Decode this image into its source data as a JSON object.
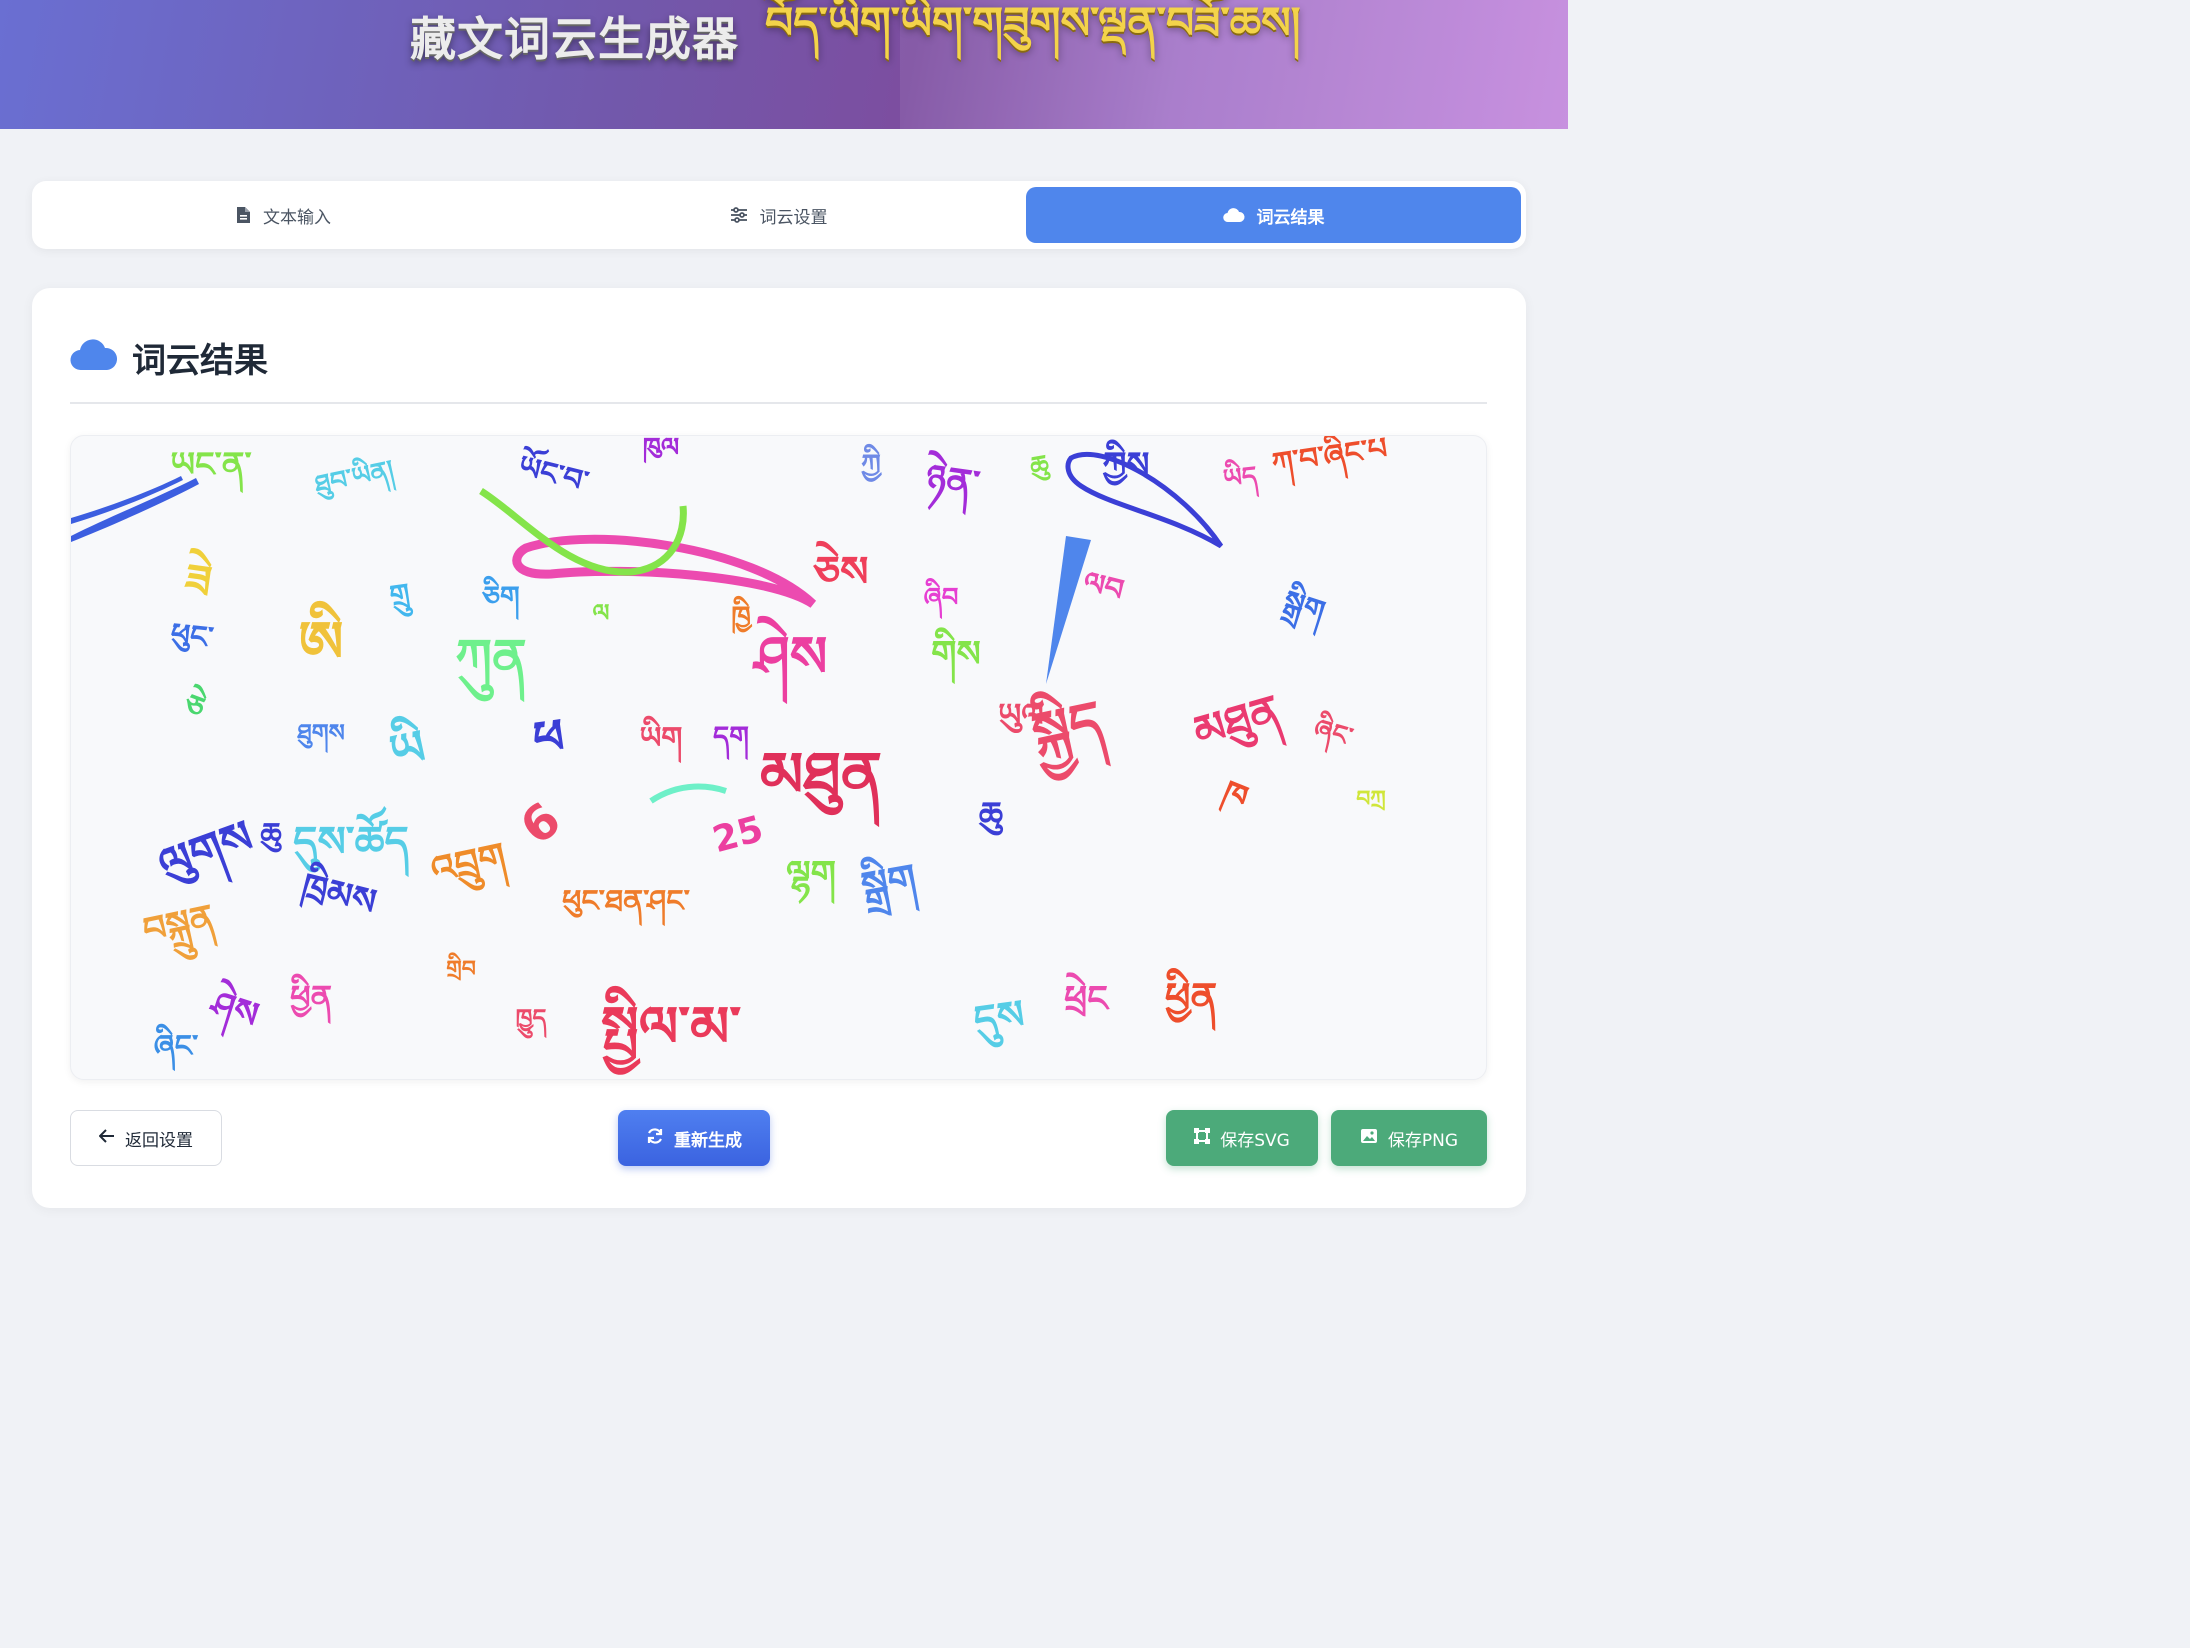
{
  "header": {
    "title_zh": "藏文词云生成器",
    "title_bo": "བོད་ཡིག་ཡིག་གཟུགས་ལྡན་བཟོ་ཆས།"
  },
  "tabs": [
    {
      "label": "文本输入",
      "icon": "file-icon",
      "active": false
    },
    {
      "label": "词云设置",
      "icon": "sliders-icon",
      "active": false
    },
    {
      "label": "词云结果",
      "icon": "cloud-icon",
      "active": true
    }
  ],
  "colors": {
    "accent": "#4f86ec",
    "save": "#4caa7a",
    "regen": "#3b63e0"
  },
  "result": {
    "title": "词云结果",
    "words": [
      {
        "t": "ཡང་ན་",
        "c": "#84e44a"
      },
      {
        "t": "ཐུབ་ཡིན།",
        "c": "#56cde6"
      },
      {
        "t": "ཡོང་བ་",
        "c": "#3b3fd6"
      },
      {
        "t": "ཁུལ",
        "c": "#a32cd9"
      },
      {
        "t": "ཀྱི",
        "c": "#6f8ae6"
      },
      {
        "t": "ཉེན་",
        "c": "#a32cd9"
      },
      {
        "t": "ཆུ",
        "c": "#84e44a"
      },
      {
        "t": "ཀྱིས",
        "c": "#3b3fd6"
      },
      {
        "t": "ཡིད",
        "c": "#ec4bb0"
      },
      {
        "t": "ཀ་བ་ཞིང་པ",
        "c": "#ee4e2c"
      },
      {
        "t": "ཟེ",
        "c": "#f0d03a"
      },
      {
        "t": "གྲུ",
        "c": "#42b7ee"
      },
      {
        "t": "ཅིག",
        "c": "#3b9fed"
      },
      {
        "t": "ལ",
        "c": "#84e44a"
      },
      {
        "t": "ཁྱི",
        "c": "#ef7c2a"
      },
      {
        "t": "ཅེས",
        "c": "#ef3f5a"
      },
      {
        "t": "ཞིབ",
        "c": "#e63fd2"
      },
      {
        "t": "ལབ",
        "c": "#ec4bb0"
      },
      {
        "t": "སྒྲིག",
        "c": "#3c6fe6"
      },
      {
        "t": "ཕུང་",
        "c": "#3c6fe6"
      },
      {
        "t": "ཅེ",
        "c": "#4ad76f"
      },
      {
        "t": "ཨི",
        "c": "#f0c23a"
      },
      {
        "t": "ཀུན",
        "c": "#6ef08c"
      },
      {
        "t": "ཤེས",
        "c": "#ec3fa0"
      },
      {
        "t": "གིས",
        "c": "#84e44a"
      },
      {
        "t": "ཐུགས",
        "c": "#4f86ec"
      },
      {
        "t": "ཡི",
        "c": "#56cde6"
      },
      {
        "t": "ཕ",
        "c": "#3b3fd6"
      },
      {
        "t": "ཡིག",
        "c": "#ec4b6b"
      },
      {
        "t": "དག",
        "c": "#a32cd9"
      },
      {
        "t": "མཐུན",
        "c": "#e0305a"
      },
      {
        "t": "ཆུ",
        "c": "#3b3fd6"
      },
      {
        "t": "ཡུལ",
        "c": "#ec4b6b"
      },
      {
        "t": "སྐྱིད",
        "c": "#ec4b6b"
      },
      {
        "t": "མཐུན",
        "c": "#ea3a70"
      },
      {
        "t": "ཞིང་",
        "c": "#ec4b6b"
      },
      {
        "t": "བཀྲ",
        "c": "#d0e63a"
      },
      {
        "t": "ཁ",
        "c": "#ee4e2c"
      },
      {
        "t": "ལུགས",
        "c": "#3b3fd6"
      },
      {
        "t": "ཆུ",
        "c": "#3b3fd6"
      },
      {
        "t": "དུས་ཚོད",
        "c": "#56cde6"
      },
      {
        "t": "འབྲུག",
        "c": "#ef8c2a"
      },
      {
        "t": "6",
        "c": "#ec4b6b"
      },
      {
        "t": "25",
        "c": "#ec3fa0"
      },
      {
        "t": "བསྐྲུན",
        "c": "#f0a03a"
      },
      {
        "t": "ཁྲིམས",
        "c": "#3b3fd6"
      },
      {
        "t": "ལྷག",
        "c": "#84e44a"
      },
      {
        "t": "སྒྲིག",
        "c": "#4f86ec"
      },
      {
        "t": "ཕུང་ཐན་ཤང་",
        "c": "#ef7c2a"
      },
      {
        "t": "ཞིང་",
        "c": "#3b8fe6"
      },
      {
        "t": "ཤེས",
        "c": "#a32cd9"
      },
      {
        "t": "ཕྱིན",
        "c": "#ec4bb0"
      },
      {
        "t": "གྲིབ",
        "c": "#ef7c2a"
      },
      {
        "t": "ཁྱུད",
        "c": "#ec4b6b"
      },
      {
        "t": "སྤྱིལ་མ་",
        "c": "#ea3a5a"
      },
      {
        "t": "དུས",
        "c": "#56cde6"
      },
      {
        "t": "ཕྲེང",
        "c": "#ec4bb0"
      },
      {
        "t": "ཕྱིན",
        "c": "#ee4e2c"
      }
    ]
  },
  "buttons": {
    "back": "返回设置",
    "regen": "重新生成",
    "save_svg": "保存SVG",
    "save_png": "保存PNG"
  }
}
